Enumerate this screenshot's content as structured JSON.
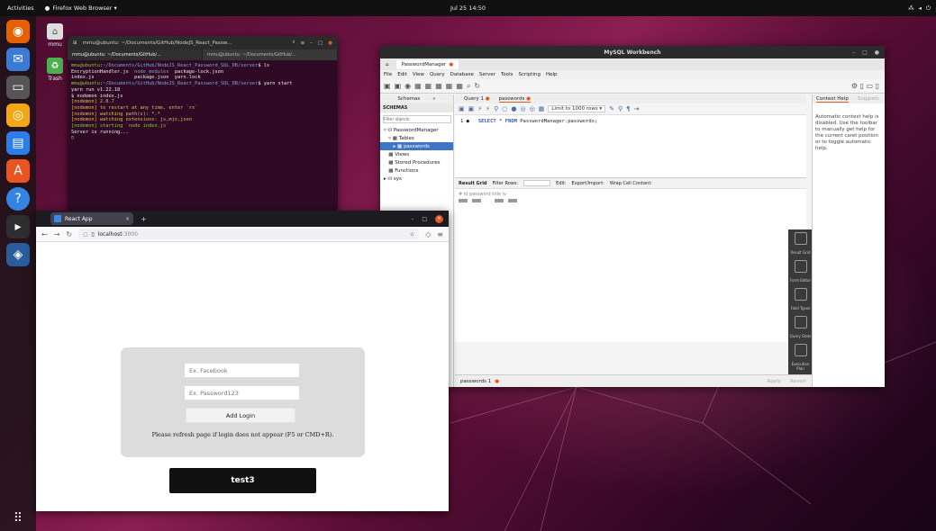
{
  "topbar": {
    "activities": "Activities",
    "app_name": "Firefox Web Browser ▾",
    "clock": "Jul 25  14:50",
    "tray_icons": [
      "network-icon",
      "volume-icon",
      "power-icon"
    ]
  },
  "desktop_icons": [
    {
      "label": "mmu"
    },
    {
      "label": "Trash"
    }
  ],
  "terminal": {
    "title": "mmu@ubuntu: ~/Documents/GitHub/NodeJS_React_Passw...",
    "tabs": [
      "mmu@ubuntu: ~/Documents/GitHub/...",
      "mmu@ubuntu: ~/Documents/GitHub/..."
    ],
    "lines": [
      {
        "parts": [
          {
            "c": "g",
            "t": "mmu@ubuntu"
          },
          {
            "c": "",
            "t": ":"
          },
          {
            "c": "b",
            "t": "~/Documents/GitHub/NodeJS_React_Password_SQL_DB/server"
          },
          {
            "c": "",
            "t": "$ ls"
          }
        ]
      },
      {
        "parts": [
          {
            "c": "",
            "t": "EncryptionHandler.js  "
          },
          {
            "c": "b",
            "t": "node_modules"
          },
          {
            "c": "",
            "t": "  package-lock.json"
          }
        ]
      },
      {
        "parts": [
          {
            "c": "",
            "t": "index.js              package.json  yarn.lock"
          }
        ]
      },
      {
        "parts": [
          {
            "c": "g",
            "t": "mmu@ubuntu"
          },
          {
            "c": "",
            "t": ":"
          },
          {
            "c": "b",
            "t": "~/Documents/GitHub/NodeJS_React_Password_SQL_DB/server"
          },
          {
            "c": "",
            "t": "$ yarn start"
          }
        ]
      },
      {
        "parts": [
          {
            "c": "",
            "t": "yarn run v1.22.18"
          }
        ]
      },
      {
        "parts": [
          {
            "c": "",
            "t": "$ nodemon index.js"
          }
        ]
      },
      {
        "parts": [
          {
            "c": "y",
            "t": "[nodemon] 2.0.7"
          }
        ]
      },
      {
        "parts": [
          {
            "c": "y",
            "t": "[nodemon] to restart at any time, enter `rs`"
          }
        ]
      },
      {
        "parts": [
          {
            "c": "y",
            "t": "[nodemon] watching path(s): *.*"
          }
        ]
      },
      {
        "parts": [
          {
            "c": "y",
            "t": "[nodemon] watching extensions: js,mjs,json"
          }
        ]
      },
      {
        "parts": [
          {
            "c": "g",
            "t": "[nodemon] starting `node index.js`"
          }
        ]
      },
      {
        "parts": [
          {
            "c": "",
            "t": "Server is running..."
          }
        ]
      },
      {
        "parts": [
          {
            "c": "",
            "t": "▯"
          }
        ]
      }
    ]
  },
  "workbench": {
    "title": "MySQL Workbench",
    "conn_tab": "PasswordManager",
    "menu": [
      "File",
      "Edit",
      "View",
      "Query",
      "Database",
      "Server",
      "Tools",
      "Scripting",
      "Help"
    ],
    "side": {
      "tabs": [
        "Schemas"
      ],
      "schemas_label": "SCHEMAS",
      "filter_placeholder": "Filter objects",
      "tree": [
        {
          "label": "▿ ⛁ PasswordManager",
          "sel": false
        },
        {
          "label": "   ▿ ▦ Tables",
          "sel": false
        },
        {
          "label": "      ▸ ▦ passwords",
          "sel": true
        },
        {
          "label": "   ▦ Views",
          "sel": false
        },
        {
          "label": "   ▦ Stored Procedures",
          "sel": false
        },
        {
          "label": "   ▦ Functions",
          "sel": false
        },
        {
          "label": "▸ ⛁ sys",
          "sel": false
        }
      ]
    },
    "query_tabs": [
      "Query 1",
      "passwords"
    ],
    "limit": "Limit to 1000 rows",
    "sql_line_no": "1 ●",
    "sql_kw1": "SELECT",
    "sql_kw2": "FROM",
    "sql_table": "PasswordManager.passwords;",
    "result": {
      "label": "Result Grid",
      "filter": "Filter Rows:",
      "edit": "Edit:",
      "export": "Export/Import:",
      "wrap": "Wrap Cell Content:",
      "cols": "#    id    password  title  iv"
    },
    "output_tab": "passwords 1",
    "apply": "Apply",
    "revert": "Revert",
    "context": {
      "tabs": [
        "Context Help",
        "Snippets"
      ],
      "text": "Automatic context help is disabled. Use the toolbar to manually get help for the current caret position or to toggle automatic help."
    },
    "right_panel": [
      "Result Grid",
      "Form Editor",
      "Field Types",
      "Query Stats",
      "Execution Plan"
    ]
  },
  "firefox": {
    "tab_title": "React App",
    "url_host": "localhost",
    "url_port": ":3000",
    "form": {
      "website_placeholder": "Ex. Facebook",
      "password_placeholder": "Ex. Password123",
      "add_label": "Add Login",
      "note": "Please refresh page if login does not appear (F5 or CMD+R)."
    },
    "items": [
      "test3"
    ]
  },
  "colors": {
    "ubuntu_orange": "#e95420",
    "terminal_bg": "#300a24",
    "selection": "#3e76c5"
  }
}
